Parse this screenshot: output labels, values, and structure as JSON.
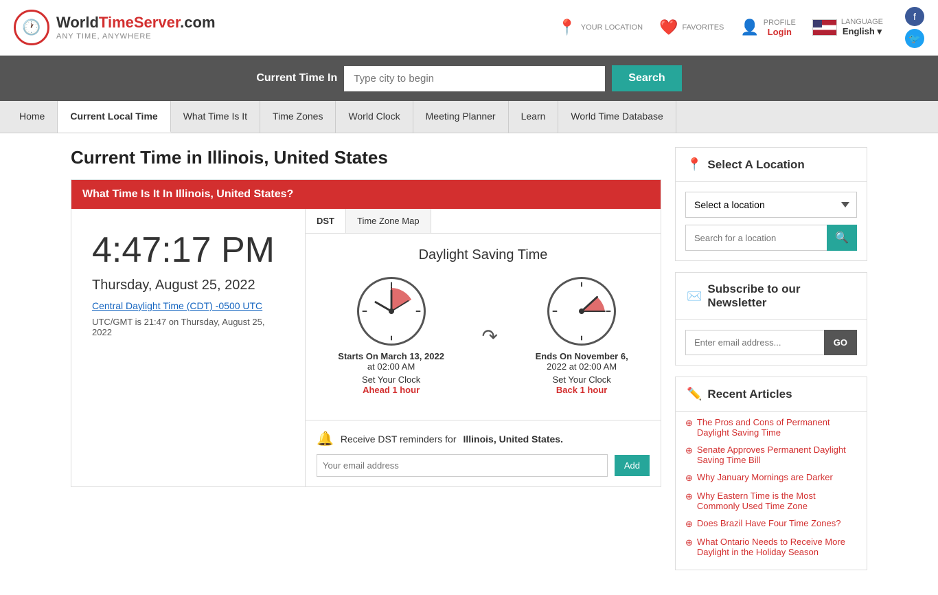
{
  "header": {
    "logo_symbol": "🕐",
    "brand_world": "World",
    "brand_time": "Time",
    "brand_server": "Server",
    "brand_domain": ".com",
    "tagline": "ANY TIME, ANYWHERE",
    "your_location_label": "YOUR LOCATION",
    "favorites_label": "FAVORITES",
    "profile_label": "PROFILE",
    "login_label": "Login",
    "language_label": "LANGUAGE",
    "language_value": "English",
    "fb_icon": "f",
    "tw_icon": "🐦"
  },
  "search": {
    "label": "Current Time In",
    "placeholder": "Type city to begin",
    "button": "Search"
  },
  "nav": {
    "items": [
      {
        "label": "Home",
        "active": false
      },
      {
        "label": "Current Local Time",
        "active": false
      },
      {
        "label": "What Time Is It",
        "active": false
      },
      {
        "label": "Time Zones",
        "active": false
      },
      {
        "label": "World Clock",
        "active": false
      },
      {
        "label": "Meeting Planner",
        "active": false
      },
      {
        "label": "Learn",
        "active": false
      },
      {
        "label": "World Time Database",
        "active": false
      }
    ]
  },
  "main": {
    "page_title": "Current Time in Illinois, United States",
    "red_banner": "What Time Is It In Illinois, United States?",
    "time": "4:47:17 PM",
    "date": "Thursday, August 25, 2022",
    "timezone_link": "Central Daylight Time (CDT) -0500 UTC",
    "utc_note": "UTC/GMT is 21:47 on Thursday, August 25, 2022"
  },
  "dst": {
    "tab_dst": "DST",
    "tab_map": "Time Zone Map",
    "title": "Daylight Saving Time",
    "starts_label": "Starts On March 13, 2022",
    "starts_time": "at 02:00 AM",
    "ends_label": "Ends On November 6,",
    "ends_label2": "2022 at 02:00 AM",
    "set_clock_label": "Set Your Clock",
    "ahead_label": "Ahead 1 hour",
    "back_label": "Back 1 hour",
    "reminder_text_pre": "Receive DST reminders for",
    "reminder_bold": "Illinois, United States.",
    "reminder_placeholder": "Your email address",
    "reminder_btn": "Add"
  },
  "sidebar": {
    "location_title": "Select A Location",
    "location_select_placeholder": "Select a location",
    "location_search_placeholder": "Search for a location",
    "newsletter_title": "Subscribe to our Newsletter",
    "newsletter_placeholder": "Enter email address...",
    "newsletter_btn": "GO",
    "articles_title": "Recent Articles",
    "articles": [
      {
        "text": "The Pros and Cons of Permanent Daylight Saving Time",
        "href": "#"
      },
      {
        "text": "Senate Approves Permanent Daylight Saving Time Bill",
        "href": "#"
      },
      {
        "text": "Why January Mornings are Darker",
        "href": "#"
      },
      {
        "text": "Why Eastern Time is the Most Commonly Used Time Zone",
        "href": "#"
      },
      {
        "text": "Does Brazil Have Four Time Zones?",
        "href": "#"
      },
      {
        "text": "What Ontario Needs to Receive More Daylight in the Holiday Season",
        "href": "#"
      }
    ]
  }
}
